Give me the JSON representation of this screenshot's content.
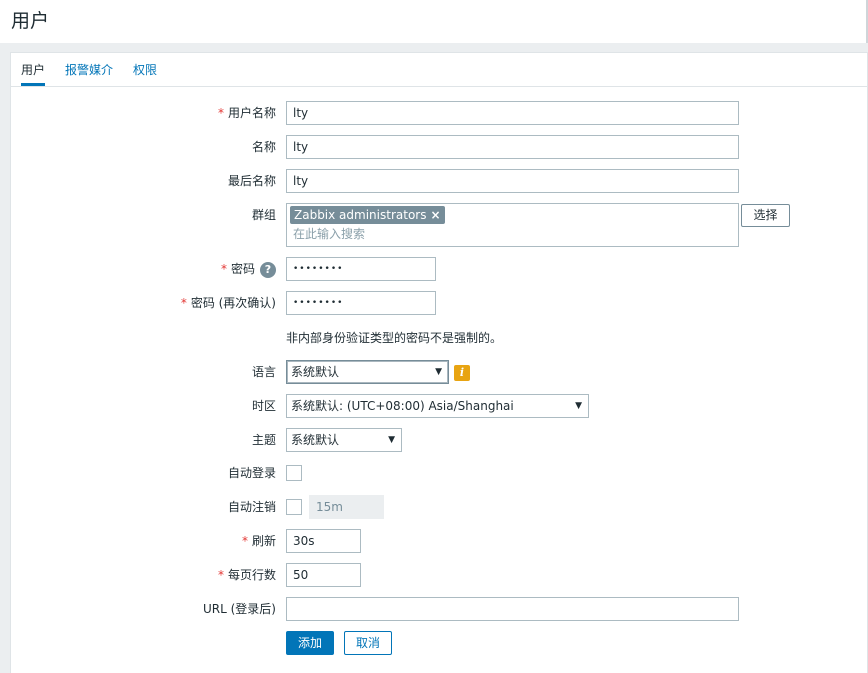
{
  "page": {
    "title": "用户"
  },
  "tabs": [
    {
      "label": "用户",
      "active": true
    },
    {
      "label": "报警媒介",
      "active": false
    },
    {
      "label": "权限",
      "active": false
    }
  ],
  "form": {
    "username": {
      "label": "用户名称",
      "required": true,
      "value": "lty"
    },
    "name": {
      "label": "名称",
      "value": "lty"
    },
    "surname": {
      "label": "最后名称",
      "value": "lty"
    },
    "groups": {
      "label": "群组",
      "selected": [
        "Zabbix administrators"
      ],
      "remove_icon": "×",
      "placeholder": "在此输入搜索",
      "select_button": "选择"
    },
    "password": {
      "label": "密码",
      "required": true,
      "value": "••••••••",
      "help_icon": "?"
    },
    "password_confirm": {
      "label": "密码 (再次确认)",
      "required": true,
      "value": "••••••••"
    },
    "password_note": "非内部身份验证类型的密码不是强制的。",
    "language": {
      "label": "语言",
      "value": "系统默认",
      "info_icon": "i"
    },
    "timezone": {
      "label": "时区",
      "value": "系统默认: (UTC+08:00) Asia/Shanghai"
    },
    "theme": {
      "label": "主题",
      "value": "系统默认"
    },
    "autologin": {
      "label": "自动登录",
      "checked": false
    },
    "autologout": {
      "label": "自动注销",
      "checked": false,
      "value": "15m"
    },
    "refresh": {
      "label": "刷新",
      "required": true,
      "value": "30s"
    },
    "rows_per_page": {
      "label": "每页行数",
      "required": true,
      "value": "50"
    },
    "url": {
      "label": "URL (登录后)",
      "value": ""
    },
    "chevron": "▼",
    "required_mark": "*",
    "add_button": "添加",
    "cancel_button": "取消"
  },
  "colors": {
    "accent": "#0275b8",
    "required": "#e33734",
    "info": "#e8a412",
    "chip": "#768d99"
  }
}
